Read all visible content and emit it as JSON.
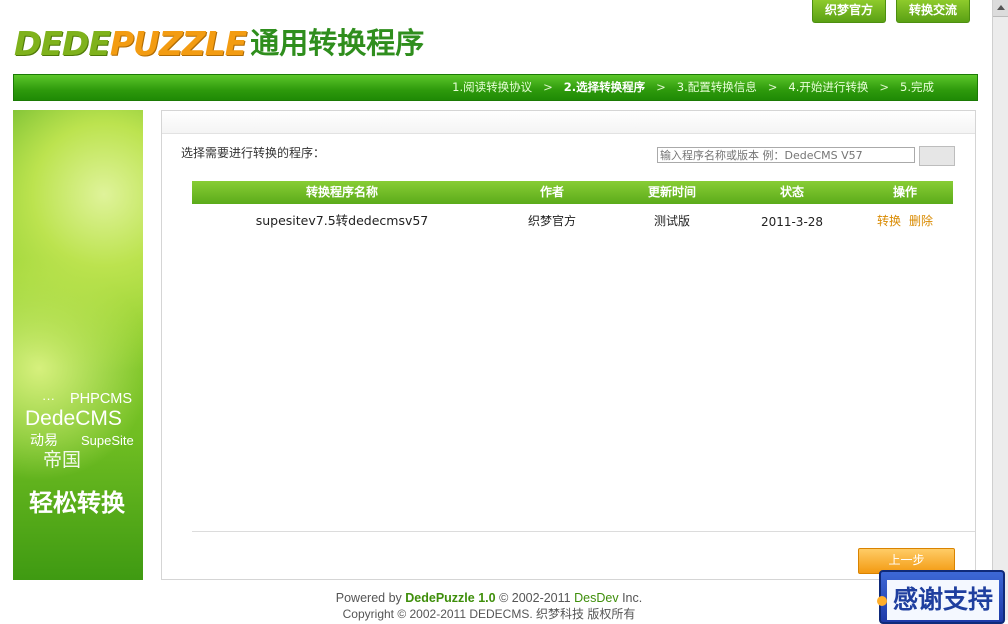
{
  "top_buttons": {
    "official": "织梦官方",
    "exchange": "转换交流"
  },
  "logo": {
    "part1": "DEDE",
    "part2": "PUZZLE",
    "subtitle": "通用转换程序"
  },
  "steps": [
    {
      "label": "1.阅读转换协议",
      "current": false
    },
    {
      "label": "2.选择转换程序",
      "current": true
    },
    {
      "label": "3.配置转换信息",
      "current": false
    },
    {
      "label": "4.开始进行转换",
      "current": false
    },
    {
      "label": "5.完成",
      "current": false
    }
  ],
  "step_separator": ">",
  "banner": {
    "dots": "···",
    "phpcms": "PHPCMS",
    "dedecms": "DedeCMS",
    "dongyi": "动易",
    "supesite": "SupeSite",
    "diguo": "帝国",
    "slogan": "轻松转换"
  },
  "main": {
    "select_label": "选择需要进行转换的程序：",
    "search_placeholder": "输入程序名称或版本 例：DedeCMS V57",
    "search_button": "",
    "columns": [
      "转换程序名称",
      "作者",
      "更新时间",
      "状态",
      "操作"
    ],
    "rows": [
      {
        "name": "supesitev7.5转dedecmsv57",
        "author": "织梦官方",
        "update": "测试版",
        "status": "2011-3-28",
        "action_convert": "转换",
        "action_delete": "删除"
      }
    ],
    "prev_button": "上一步"
  },
  "footer": {
    "powered_prefix": "Powered by",
    "product": "DedePuzzle 1.0",
    "copy_mid": "© 2002-2011",
    "company": "DesDev",
    "company_suffix": "Inc.",
    "line2": "Copyright © 2002-2011 DEDECMS. 织梦科技 版权所有"
  },
  "thanks_badge": "感谢支持",
  "colors": {
    "brand_green": "#3e8e0a",
    "accent_orange": "#f39a12",
    "step_bar": "#2e9a0c"
  }
}
